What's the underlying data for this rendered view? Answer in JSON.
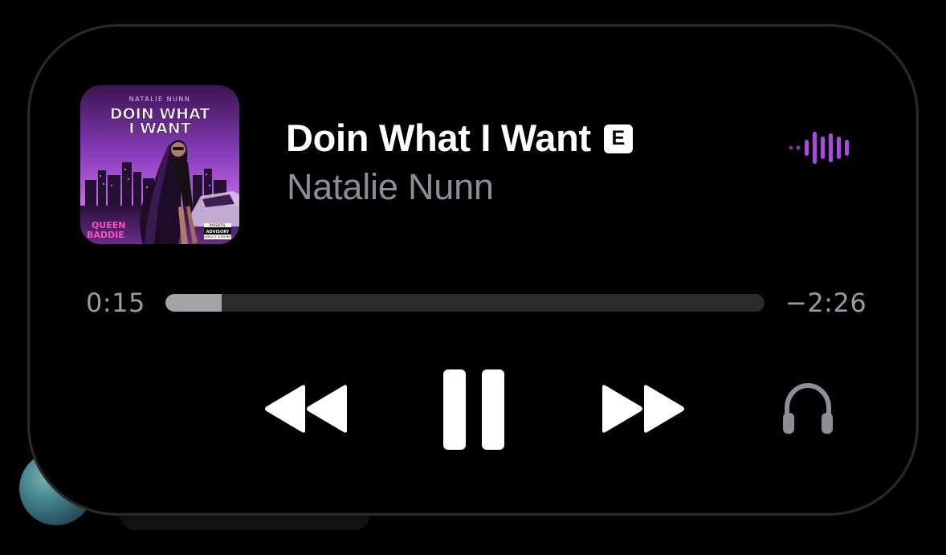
{
  "now_playing": {
    "title": "Doin What I Want",
    "explicit_badge": "E",
    "artist": "Natalie Nunn",
    "artwork": {
      "artist_text": "NATALIE NUNN",
      "title_text": "DOIN WHAT I WANT",
      "corner_text": "QUEEN BADDIE",
      "label_text": "PARENTAL ADVISORY EXPLICIT CONTENT"
    }
  },
  "progress": {
    "elapsed": "0:15",
    "remaining": "−2:26",
    "fraction": 0.094
  },
  "controls": {
    "rewind_icon": "rewind-icon",
    "pause_icon": "pause-icon",
    "forward_icon": "fast-forward-icon",
    "output_icon": "headphones-icon"
  },
  "colors": {
    "background": "#000000",
    "title": "#ffffff",
    "artist": "#8d8d92",
    "accent_waveform": "#a64fd6",
    "track": "#2b2b2e",
    "track_fill": "#a3a3a8",
    "headphones": "#8e8e93"
  }
}
